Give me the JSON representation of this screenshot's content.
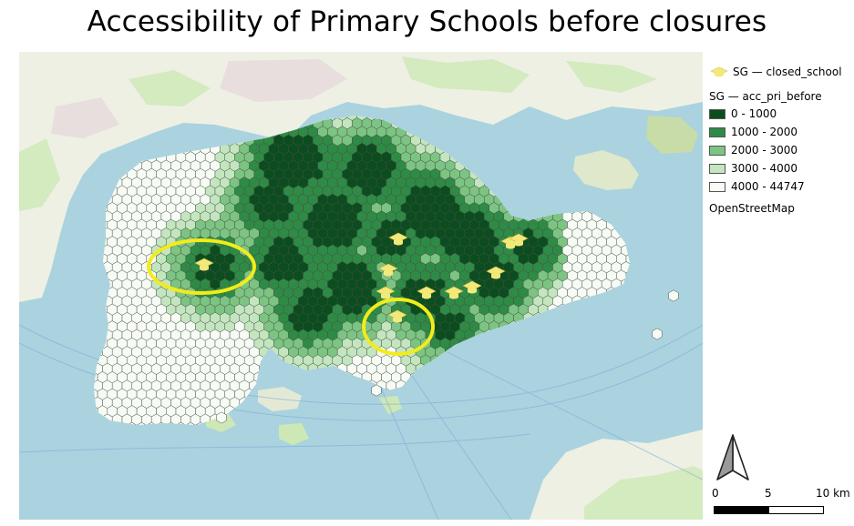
{
  "title": "Accessibility of Primary Schools before closures",
  "legend": {
    "closed_layer": "SG — closed_school",
    "acc_layer": "SG — acc_pri_before",
    "classes": [
      {
        "label": "0 - 1000",
        "color": "#0b4d1e"
      },
      {
        "label": "1000 - 2000",
        "color": "#2e8b45"
      },
      {
        "label": "2000 - 3000",
        "color": "#7cc482"
      },
      {
        "label": "3000 - 4000",
        "color": "#c3e6bf"
      },
      {
        "label": "4000 - 44747",
        "color": "#f6fbf4"
      }
    ],
    "basemap": "OpenStreetMap"
  },
  "scale_bar": {
    "labels": [
      "0",
      "5",
      "10 km"
    ]
  },
  "colors": {
    "sea": "#aad3df",
    "land": "#eef0e4",
    "highlight_ring": "#f1ec1c",
    "school_icon": "#f3e97a"
  }
}
